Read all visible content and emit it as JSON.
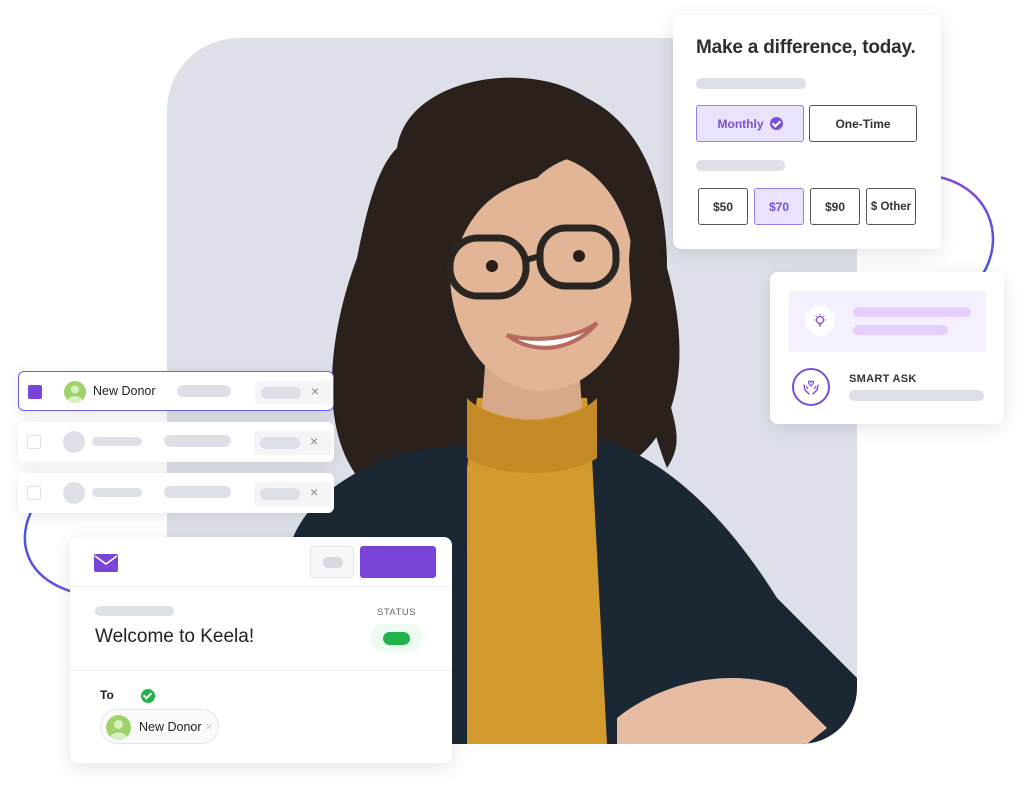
{
  "donation_form": {
    "title": "Make a difference, today.",
    "frequency_options": [
      {
        "label": "Monthly",
        "selected": true
      },
      {
        "label": "One-Time",
        "selected": false
      }
    ],
    "amount_options": [
      {
        "label": "$50",
        "selected": false
      },
      {
        "label": "$70",
        "selected": true
      },
      {
        "label": "$90",
        "selected": false
      },
      {
        "label": "$ Other",
        "selected": false
      }
    ]
  },
  "smart_ask": {
    "label": "SMART ASK",
    "icons": [
      "lightbulb-icon",
      "heart-hands-icon"
    ]
  },
  "donor_list": {
    "rows": [
      {
        "name": "New Donor",
        "checked": true
      },
      {
        "name": "",
        "checked": false
      },
      {
        "name": "",
        "checked": false
      }
    ],
    "remove_glyph": "×"
  },
  "email": {
    "subject": "Welcome to Keela!",
    "status_label": "STATUS",
    "status": "active",
    "to_label": "To",
    "recipient": "New Donor",
    "remove_glyph": "×",
    "icon": "envelope-icon"
  },
  "colors": {
    "brand_purple": "#7a44d9",
    "selected_bg": "#ebe3fb",
    "status_green": "#22b24c",
    "photo_bg": "#dde0e8",
    "arrow_gradient": [
      "#3b5be0",
      "#8a46d9"
    ]
  }
}
